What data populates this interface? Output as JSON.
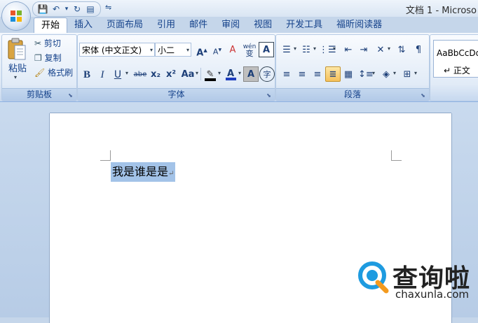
{
  "window": {
    "title": "文档 1 - Microso"
  },
  "quick_access": {
    "save": "💾",
    "undo": "↶",
    "undo_dd": "▾",
    "redo": "↻",
    "print": "▤",
    "more": "⇋"
  },
  "tabs": [
    "开始",
    "插入",
    "页面布局",
    "引用",
    "邮件",
    "审阅",
    "视图",
    "开发工具",
    "福昕阅读器"
  ],
  "clipboard": {
    "label": "剪贴板",
    "paste": "粘贴",
    "cut": "剪切",
    "copy": "复制",
    "format_painter": "格式刷"
  },
  "font": {
    "label": "字体",
    "font_name": "宋体 (中文正文)",
    "font_size": "小二",
    "grow": "A",
    "shrink": "A",
    "clear": "A",
    "phonetic": "wén",
    "char_border": "A",
    "bold": "B",
    "italic": "I",
    "underline": "U",
    "strike": "abe",
    "subscript": "x₂",
    "superscript": "x²",
    "change_case": "Aa",
    "font_color": "A",
    "char_shading": "A",
    "enclose": "字"
  },
  "paragraph": {
    "label": "段落"
  },
  "styles": {
    "sample": "AaBbCcDd",
    "name": "正文"
  },
  "document": {
    "text": "我是谁是是"
  },
  "watermark": {
    "brand_cn": "查询啦",
    "brand_en": "chaxunla.com"
  },
  "colors": {
    "accent": "#15428b",
    "highlight": "#f6c05a",
    "selection": "#a3c3e8",
    "logo_blue": "#1e9be0",
    "logo_orange": "#f39a1e"
  }
}
